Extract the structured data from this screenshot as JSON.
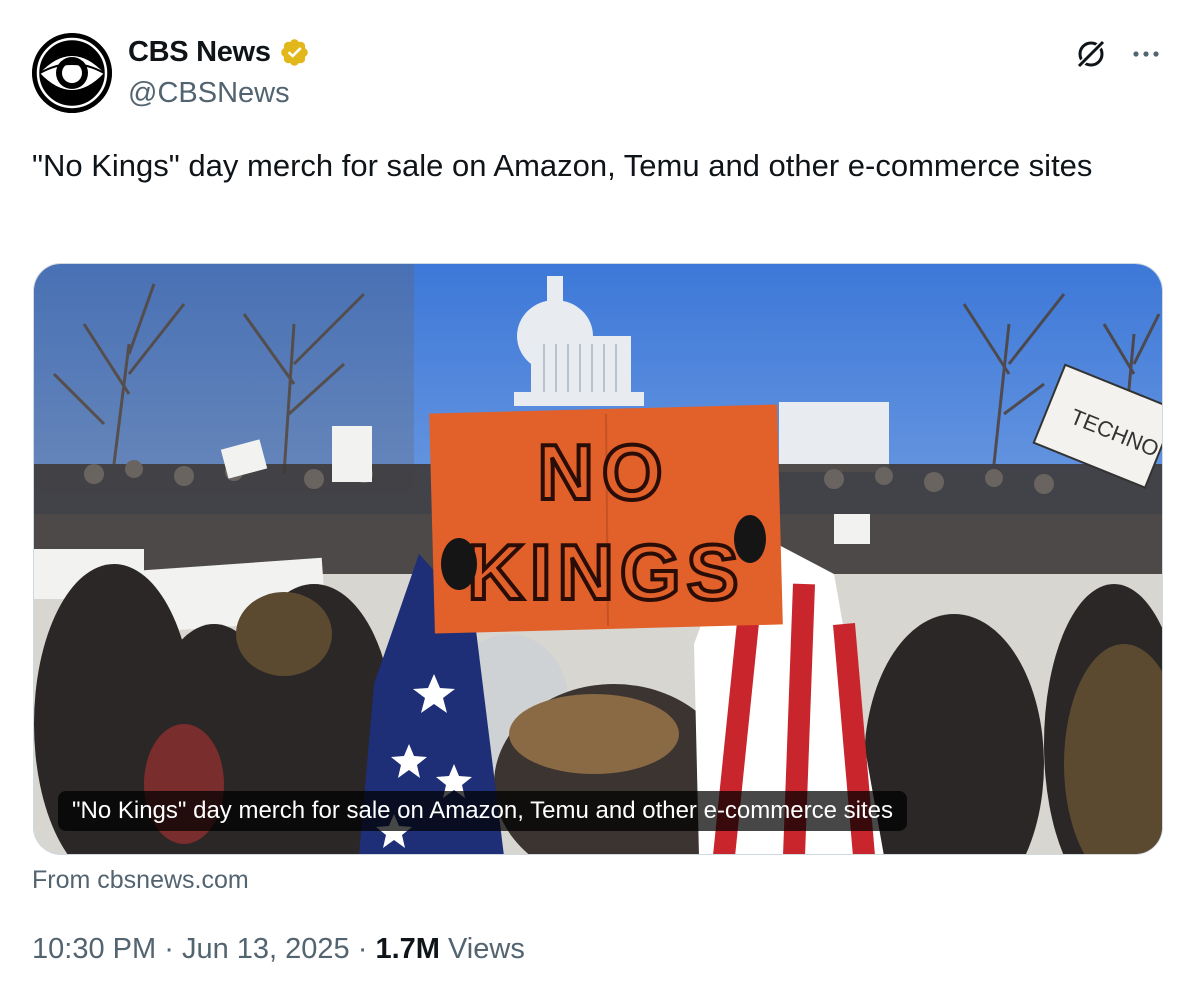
{
  "account": {
    "display_name": "CBS News",
    "handle": "@CBSNews",
    "verified_badge_color": "#e2b719",
    "avatar_icon": "cbs-eye-logo-icon"
  },
  "tweet": {
    "text": "\"No Kings\" day merch for sale on Amazon, Temu and other e-commerce sites"
  },
  "media": {
    "caption": "\"No Kings\" day merch for sale on Amazon, Temu and other e-commerce sites",
    "sign_text_line1": "NO",
    "sign_text_line2": "KINGS",
    "sign_color": "#e2602a",
    "background_sign_text": "TECHNO"
  },
  "source": {
    "label": "From cbsnews.com"
  },
  "meta": {
    "time": "10:30 PM",
    "separator": "·",
    "date": "Jun 13, 2025",
    "views_count": "1.7M",
    "views_label": "Views"
  },
  "icons": {
    "grok": "grok-icon",
    "more": "more-options-icon"
  }
}
